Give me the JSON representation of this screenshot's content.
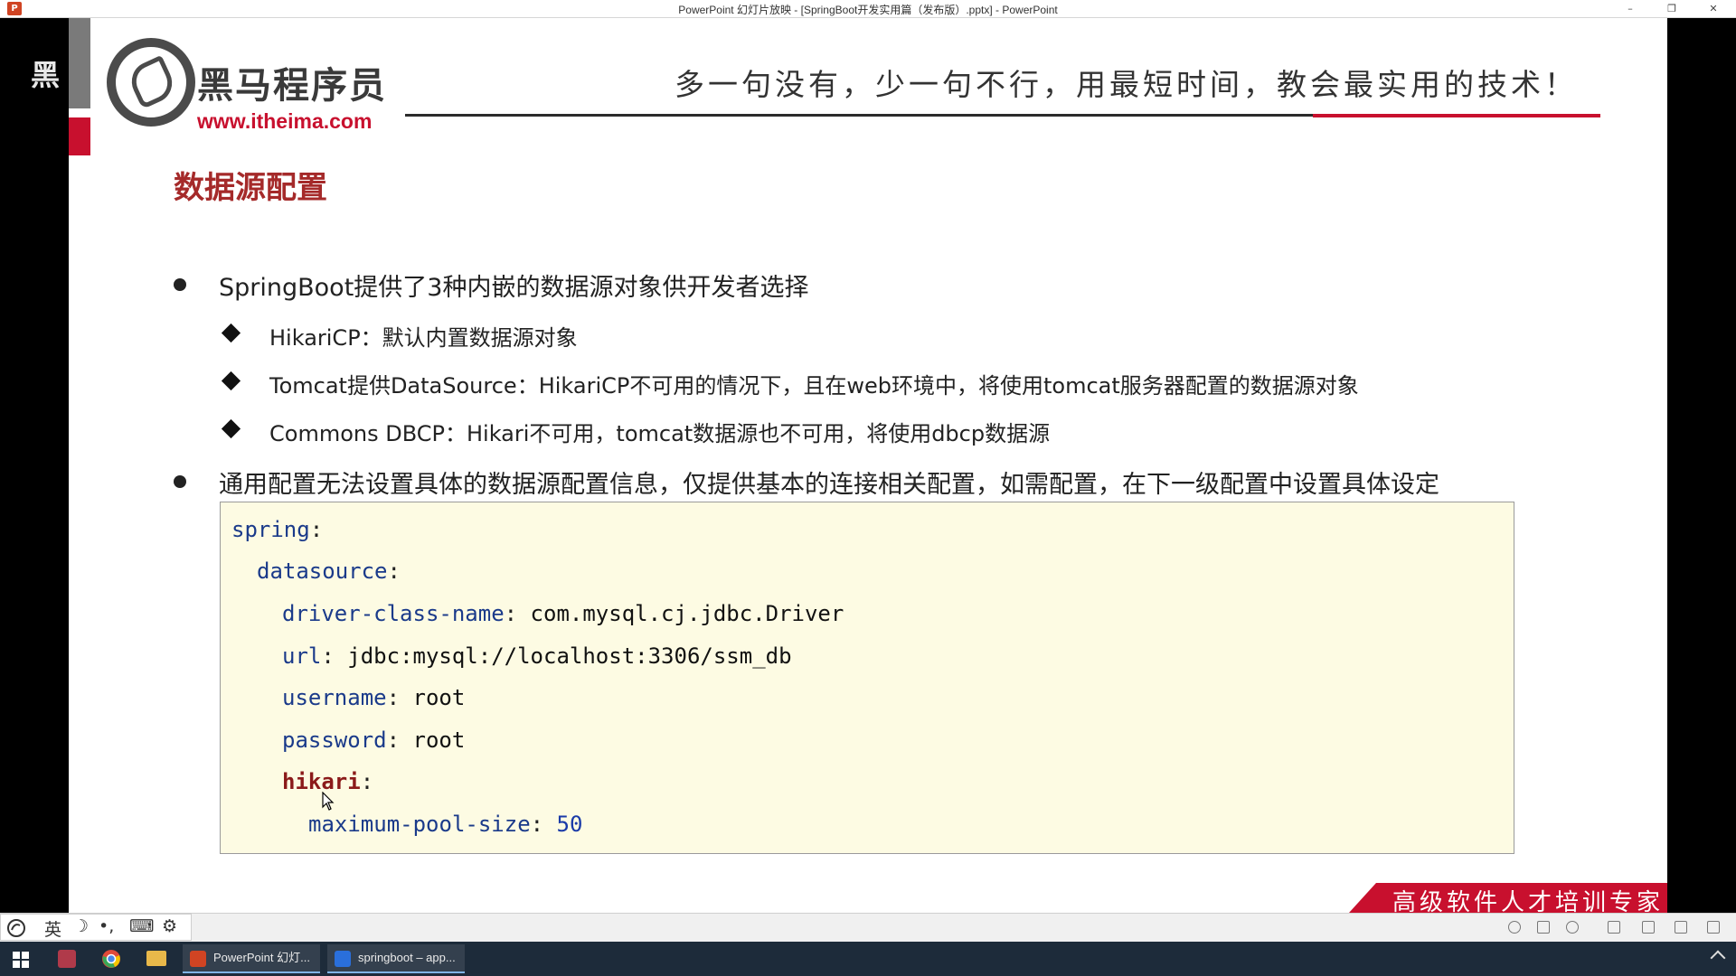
{
  "window": {
    "title": "PowerPoint 幻灯片放映 - [SpringBoot开发实用篇（发布版）.pptx] - PowerPoint",
    "app_icon": "P",
    "controls": [
      "–",
      "❐",
      "✕"
    ]
  },
  "watermark": "黑",
  "logo": {
    "brand_cn": "黑马程序员",
    "url": "www.itheima.com"
  },
  "slogan": "多一句没有，少一句不行，用最短时间，教会最实用的技术！",
  "slide": {
    "title": "数据源配置",
    "bullets": [
      "SpringBoot提供了3种内嵌的数据源对象供开发者选择",
      "通用配置无法设置具体的数据源配置信息，仅提供基本的连接相关配置，如需配置，在下一级配置中设置具体设定"
    ],
    "sub_bullets": [
      "HikariCP：默认内置数据源对象",
      "Tomcat提供DataSource：HikariCP不可用的情况下，且在web环境中，将使用tomcat服务器配置的数据源对象",
      "Commons DBCP：Hikari不可用，tomcat数据源也不可用，将使用dbcp数据源"
    ],
    "code": {
      "l1_key": "spring",
      "l2_key": "datasource",
      "l3_key": "driver-class-name",
      "l3_val": "com.mysql.cj.jdbc.Driver",
      "l4_key": "url",
      "l4_val": "jdbc:mysql://localhost:3306/ssm_db",
      "l5_key": "username",
      "l5_val": "root",
      "l6_key": "password",
      "l6_val": "root",
      "l7_key": "hikari",
      "l8_key": "maximum-pool-size",
      "l8_val": "50",
      "colon": ":"
    },
    "footer_banner": "高级软件人才培训专家"
  },
  "statusbar": {
    "ime": [
      "英",
      "☽",
      "•,",
      "⌨",
      "⚙"
    ]
  },
  "taskbar": {
    "items": [
      {
        "label": "PowerPoint 幻灯...",
        "icon": "powerpoint-icon"
      },
      {
        "label": "springboot – app...",
        "icon": "intellij-icon"
      }
    ]
  },
  "colors": {
    "accent_red": "#c8102e",
    "title_red": "#a52a2a",
    "code_key": "#1a3a8a",
    "code_bg": "#fdfbe3"
  }
}
